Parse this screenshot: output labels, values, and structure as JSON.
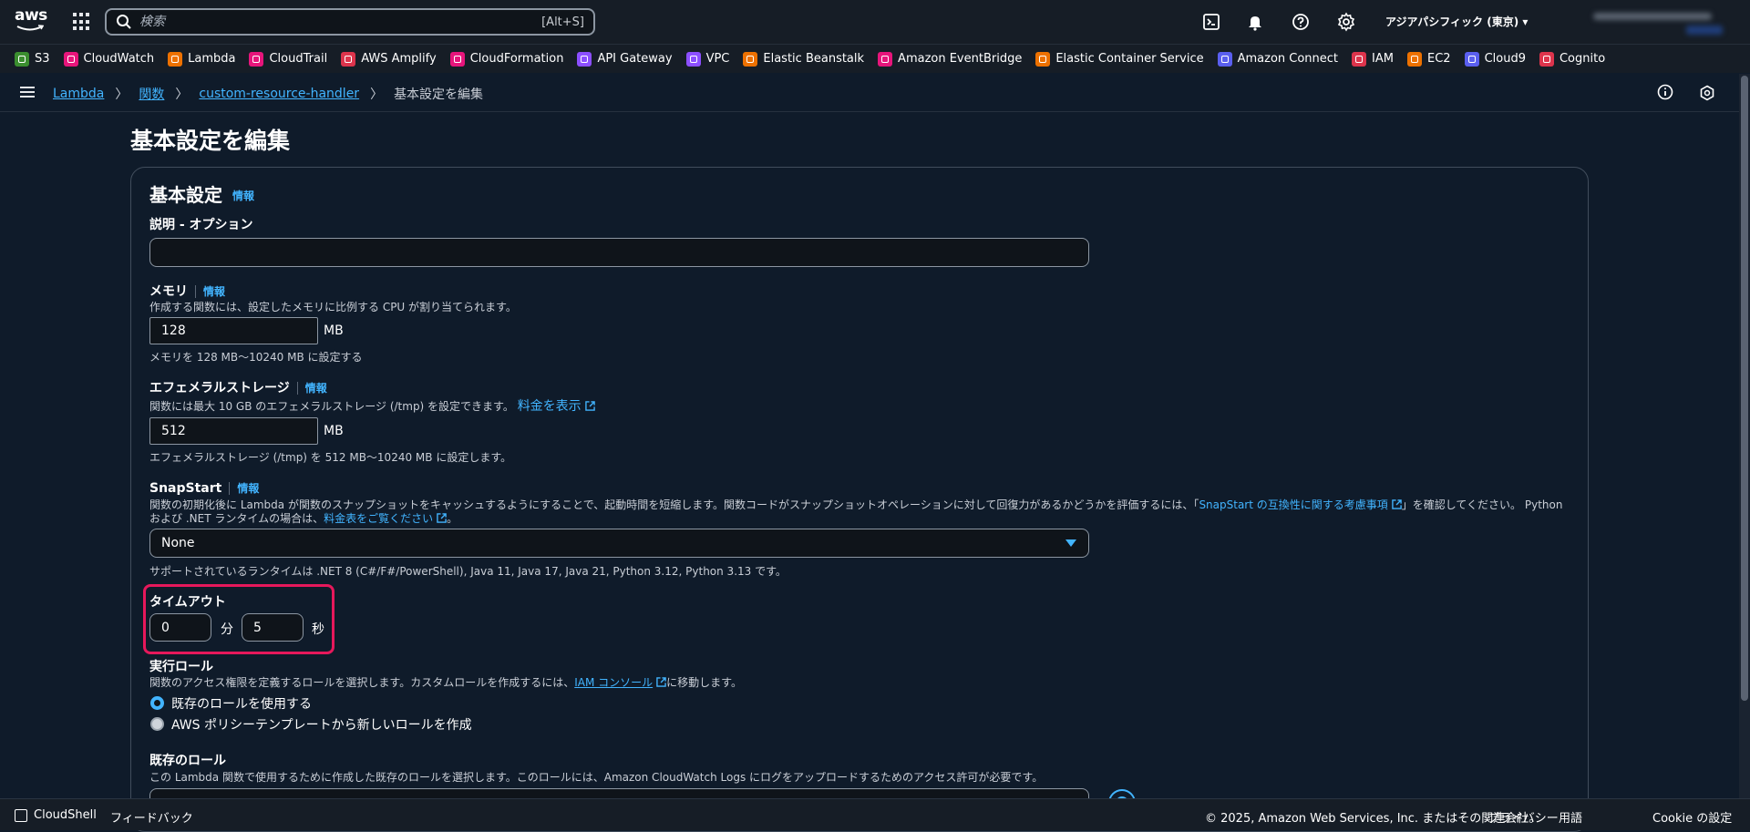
{
  "topbar": {
    "logo_text": "aws",
    "search_placeholder": "検索",
    "search_shortcut": "[Alt+S]",
    "region": "アジアパシフィック (東京) ▾"
  },
  "favorites": [
    {
      "label": "S3",
      "color": "#3b8e2f"
    },
    {
      "label": "CloudWatch",
      "color": "#e7157b"
    },
    {
      "label": "Lambda",
      "color": "#ed7100"
    },
    {
      "label": "CloudTrail",
      "color": "#e7157b"
    },
    {
      "label": "AWS Amplify",
      "color": "#dd344c"
    },
    {
      "label": "CloudFormation",
      "color": "#e7157b"
    },
    {
      "label": "API Gateway",
      "color": "#8c4fff"
    },
    {
      "label": "VPC",
      "color": "#8c4fff"
    },
    {
      "label": "Elastic Beanstalk",
      "color": "#ed7100"
    },
    {
      "label": "Amazon EventBridge",
      "color": "#e7157b"
    },
    {
      "label": "Elastic Container Service",
      "color": "#ed7100"
    },
    {
      "label": "Amazon Connect",
      "color": "#5a5ff0"
    },
    {
      "label": "IAM",
      "color": "#dd344c"
    },
    {
      "label": "EC2",
      "color": "#ed7100"
    },
    {
      "label": "Cloud9",
      "color": "#5a5ff0"
    },
    {
      "label": "Cognito",
      "color": "#dd344c"
    }
  ],
  "breadcrumb": {
    "items": [
      "Lambda",
      "関数",
      "custom-resource-handler"
    ],
    "current": "基本設定を編集"
  },
  "page": {
    "title": "基本設定を編集",
    "section_title": "基本設定",
    "info": "情報"
  },
  "form": {
    "description": {
      "label": "説明 - オプション",
      "value": ""
    },
    "memory": {
      "label": "メモリ",
      "desc": "作成する関数には、設定したメモリに比例する CPU が割り当てられます。",
      "value": "128",
      "unit": "MB",
      "hint": "メモリを 128 MB〜10240 MB に設定する"
    },
    "ephemeral": {
      "label": "エフェメラルストレージ",
      "desc": "関数には最大 10 GB のエフェメラルストレージ (/tmp) を設定できます。",
      "link": "料金を表示",
      "value": "512",
      "unit": "MB",
      "hint": "エフェメラルストレージ (/tmp) を 512 MB〜10240 MB に設定します。"
    },
    "snapstart": {
      "label": "SnapStart",
      "desc1": "関数の初期化後に Lambda が関数のスナップショットをキャッシュするようにすることで、起動時間を短縮します。関数コードがスナップショットオペレーションに対して回復力があるかどうかを評価するには、「",
      "link1": "SnapStart の互換性に関する考慮事項",
      "desc2": "」を確認してください。 Python",
      "desc3": "および .NET ランタイムの場合は、",
      "link2": "料金表をご覧ください",
      "desc4": "。",
      "value": "None",
      "hint": "サポートされているランタイムは .NET 8 (C#/F#/PowerShell), Java 11, Java 17, Java 21, Python 3.12, Python 3.13 です。"
    },
    "timeout": {
      "label": "タイムアウト",
      "minutes": "0",
      "min_unit": "分",
      "seconds": "5",
      "sec_unit": "秒"
    },
    "role": {
      "label": "実行ロール",
      "desc_pre": "関数のアクセス権限を定義するロールを選択します。カスタムロールを作成するには、",
      "link": "IAM コンソール",
      "desc_post": "に移動します。",
      "option1": "既存のロールを使用する",
      "option2": "AWS ポリシーテンプレートから新しいロールを作成"
    },
    "existing_role": {
      "label": "既存のロール",
      "desc": "この Lambda 関数で使用するために作成した既存のロールを選択します。このロールには、Amazon CloudWatch Logs にログをアップロードするためのアクセス許可が必要です。"
    }
  },
  "footer": {
    "cloudshell": "CloudShell",
    "feedback": "フィードバック",
    "copyright": "© 2025, Amazon Web Services, Inc. またはその関連会社。",
    "privacy": "プライバシー",
    "terms": "用語",
    "cookie": "Cookie の設定"
  }
}
